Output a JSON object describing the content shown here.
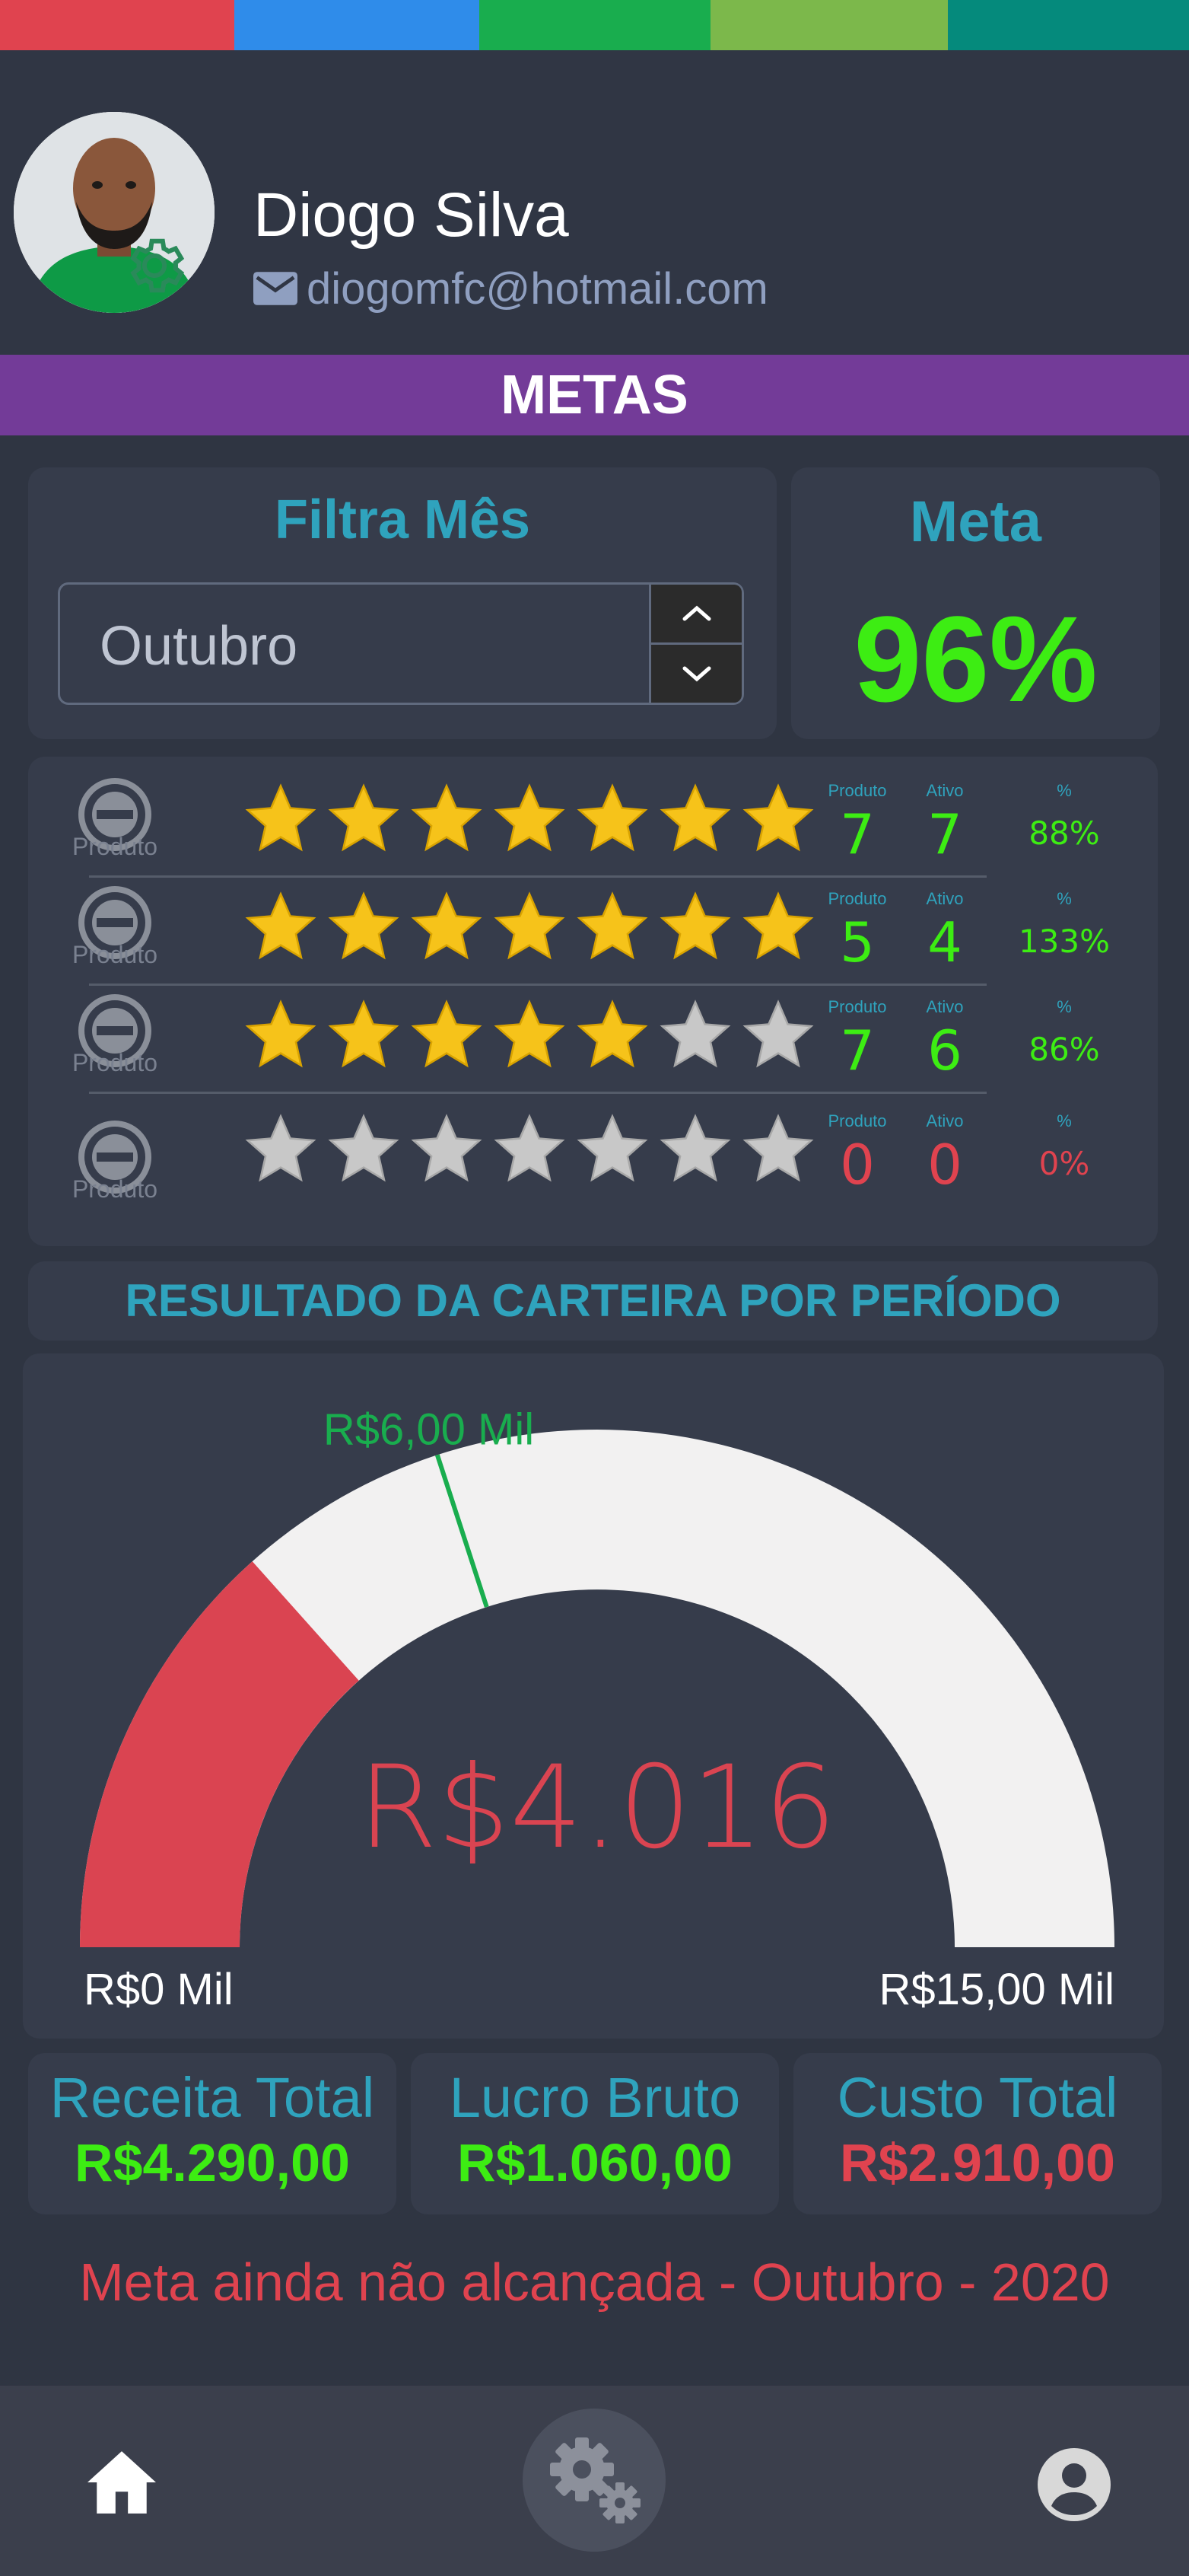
{
  "colors": {
    "accent_teal": "#2fa3bd",
    "success_green": "#3ded13",
    "danger_red": "#e0434f",
    "banner_purple": "#733b98",
    "star_gold": "#f6c31a",
    "star_gray": "#c8c8c8",
    "top_stripes": [
      "#e0434f",
      "#2f8cea",
      "#19ad4e",
      "#7cb84b",
      "#058a7c"
    ]
  },
  "profile": {
    "name": "Diogo Silva",
    "email": "diogomfc@hotmail.com",
    "avatar_icon": "user-photo",
    "settings_icon": "gear-icon"
  },
  "banner": {
    "title": "METAS"
  },
  "filter": {
    "title": "Filtra Mês",
    "selected_month": "Outubro"
  },
  "meta": {
    "title": "Meta",
    "value": "96%"
  },
  "products": [
    {
      "label": "Produto",
      "stars_filled": 7,
      "stars_total": 7,
      "col_headers": [
        "Produto",
        "Ativo",
        "%"
      ],
      "produto": "7",
      "ativo": "7",
      "percent": "88%",
      "status": "ok"
    },
    {
      "label": "Produto",
      "stars_filled": 7,
      "stars_total": 7,
      "col_headers": [
        "Produto",
        "Ativo",
        "%"
      ],
      "produto": "5",
      "ativo": "4",
      "percent": "133%",
      "status": "ok"
    },
    {
      "label": "Produto",
      "stars_filled": 5,
      "stars_total": 7,
      "col_headers": [
        "Produto",
        "Ativo",
        "%"
      ],
      "produto": "7",
      "ativo": "6",
      "percent": "86%",
      "status": "ok"
    },
    {
      "label": "Produto",
      "stars_filled": 0,
      "stars_total": 7,
      "col_headers": [
        "Produto",
        "Ativo",
        "%"
      ],
      "produto": "0",
      "ativo": "0",
      "percent": "0%",
      "status": "bad"
    }
  ],
  "result": {
    "title": "RESULTADO DA CARTEIRA POR PERÍODO"
  },
  "gauge": {
    "target_label": "R$6,00 Mil",
    "target_value": 6000,
    "current_label": "R$4.016",
    "current_value": 4016,
    "min_label": "R$0 Mil",
    "max_label": "R$15,00 Mil",
    "min": 0,
    "max": 15000
  },
  "summary": [
    {
      "title": "Receita Total",
      "value": "R$4.290,00",
      "color": "#3ded13"
    },
    {
      "title": "Lucro Bruto",
      "value": "R$1.060,00",
      "color": "#3ded13"
    },
    {
      "title": "Custo Total",
      "value": "R$2.910,00",
      "color": "#e0434f"
    }
  ],
  "status_message": "Meta ainda não alcançada - Outubro - 2020",
  "nav": {
    "home_icon": "home-icon",
    "center_icon": "gears-icon",
    "profile_icon": "account-circle-icon"
  }
}
